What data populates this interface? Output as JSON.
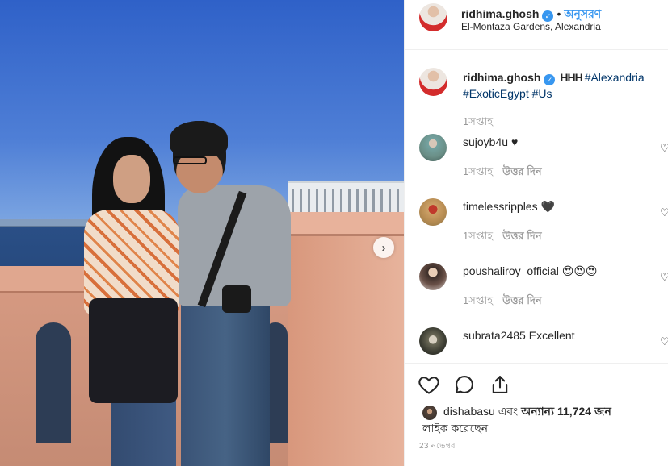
{
  "post": {
    "owner": "ridhima.ghosh",
    "follow_label": "অনুসরণ",
    "location": "El-Montaza Gardens, Alexandria",
    "caption": {
      "brand": "HHH",
      "tags": [
        "#Alexandria",
        "#ExoticEgypt",
        "#Us"
      ],
      "time": "1সপ্তাহ"
    },
    "comments": [
      {
        "user": "sujoyb4u",
        "text": "♥",
        "time": "1সপ্তাহ",
        "reply": "উত্তর দিন"
      },
      {
        "user": "timelessripples",
        "text": "🖤",
        "time": "1সপ্তাহ",
        "reply": "উত্তর দিন"
      },
      {
        "user": "poushaliroy_official",
        "text": "😍😍😍",
        "time": "1সপ্তাহ",
        "reply": "উত্তর দিন"
      },
      {
        "user": "subrata2485",
        "text": "Excellent"
      }
    ],
    "likes": {
      "user": "dishabasu",
      "connector": "এবং",
      "others": "অন্যান্য 11,724 জন",
      "suffix": "লাইক করেছেন"
    },
    "date": "23 নভেম্বর"
  },
  "icons": {
    "verified": "verified-badge-icon",
    "next": "chevron-right-icon",
    "like": "heart-outline-icon",
    "comment": "speech-bubble-icon",
    "share": "share-upload-icon"
  },
  "colors": {
    "link": "#3897f0",
    "hashtag": "#003569",
    "muted": "#999999"
  }
}
